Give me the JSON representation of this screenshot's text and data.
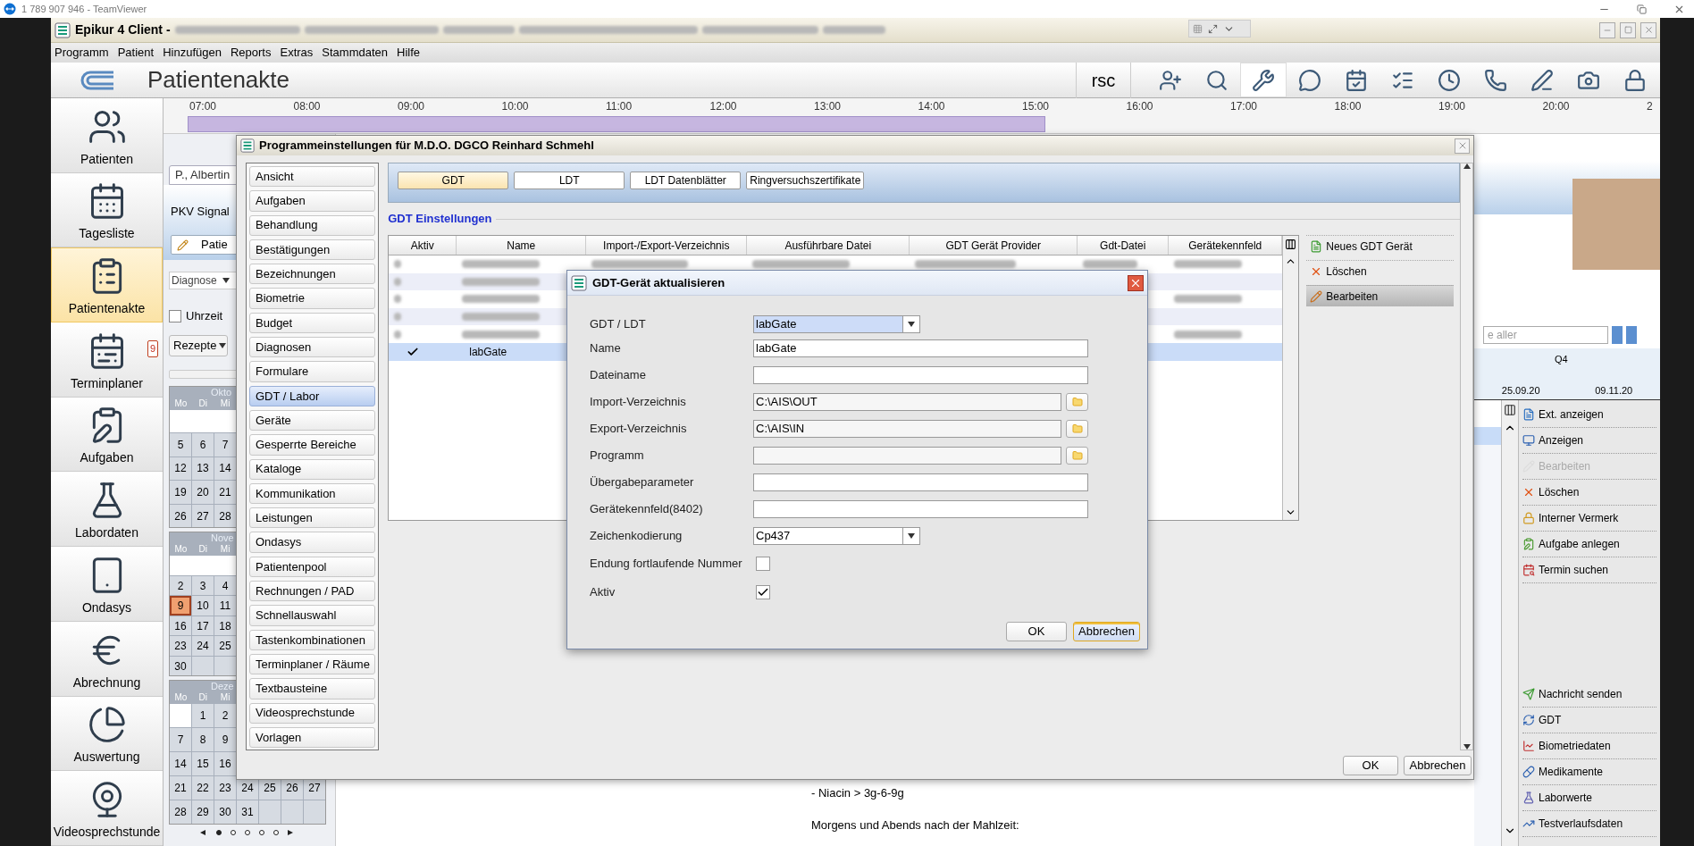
{
  "teamviewer": {
    "title": "1 789 907 946 - TeamViewer"
  },
  "app_window": {
    "title": "Epikur 4 Client -"
  },
  "menu": [
    "Programm",
    "Patient",
    "Hinzufügen",
    "Reports",
    "Extras",
    "Stammdaten",
    "Hilfe"
  ],
  "header": {
    "title": "Patientenakte",
    "user": "rsc",
    "toolbar": [
      {
        "kind": "add-patient",
        "selected": false
      },
      {
        "kind": "search-calendar",
        "selected": false
      },
      {
        "kind": "tools",
        "selected": true
      },
      {
        "kind": "chat",
        "selected": false
      },
      {
        "kind": "clipboard-calendar",
        "selected": false
      },
      {
        "kind": "clipboard-check",
        "selected": false
      },
      {
        "kind": "clipboard-clock",
        "selected": false
      },
      {
        "kind": "clipboard-phone",
        "selected": false
      },
      {
        "kind": "list-pen",
        "selected": false
      },
      {
        "kind": "camera",
        "selected": false
      },
      {
        "kind": "user-lock",
        "selected": false
      }
    ]
  },
  "nav": [
    {
      "label": "Patienten",
      "selected": false
    },
    {
      "label": "Tagesliste",
      "selected": false
    },
    {
      "label": "Patientenakte",
      "selected": true
    },
    {
      "label": "Terminplaner",
      "selected": false,
      "badge": "9"
    },
    {
      "label": "Aufgaben",
      "selected": false
    },
    {
      "label": "Labordaten",
      "selected": false
    },
    {
      "label": "Ondasys",
      "selected": false
    },
    {
      "label": "Abrechnung",
      "selected": false
    },
    {
      "label": "Auswertung",
      "selected": false
    },
    {
      "label": "Videosprechstunde",
      "selected": false
    }
  ],
  "timeline": {
    "hours": [
      "07:00",
      "08:00",
      "09:00",
      "10:00",
      "11:00",
      "12:00",
      "13:00",
      "14:00",
      "15:00",
      "16:00",
      "17:00",
      "18:00",
      "19:00",
      "20:00",
      "2"
    ]
  },
  "patient_panel": {
    "tab": "P., Albertin",
    "insurance": "PKV Signal",
    "patient_button": "Patie",
    "diagnosis_dropdown": "Diagnose",
    "time_checkbox": {
      "label": "Uhrzeit",
      "checked": false
    },
    "prescriptions_button": "Rezepte"
  },
  "calendar": {
    "months": [
      {
        "name": "Okto",
        "weekdays": [
          "Mo",
          "Di",
          "Mi"
        ],
        "weeks": [
          {
            "kind": "blank"
          },
          [
            {
              "day": "5",
              "selected": false
            },
            {
              "day": "6",
              "selected": false
            },
            {
              "day": "7",
              "selected": false
            }
          ],
          [
            {
              "day": "12",
              "selected": false
            },
            {
              "day": "13",
              "selected": false
            },
            {
              "day": "14",
              "selected": false
            }
          ],
          [
            {
              "day": "19",
              "selected": false
            },
            {
              "day": "20",
              "selected": false
            },
            {
              "day": "21",
              "selected": false
            }
          ],
          [
            {
              "day": "26",
              "selected": false
            },
            {
              "day": "27",
              "selected": false
            },
            {
              "day": "28",
              "selected": false
            }
          ]
        ]
      },
      {
        "name": "Nove",
        "weekdays": [
          "Mo",
          "Di",
          "Mi"
        ],
        "weeks": [
          {
            "kind": "blank"
          },
          [
            {
              "day": "2",
              "selected": false
            },
            {
              "day": "3",
              "selected": false
            },
            {
              "day": "4",
              "selected": false
            }
          ],
          [
            {
              "day": "9",
              "selected": true
            },
            {
              "day": "10",
              "selected": false
            },
            {
              "day": "11",
              "selected": false
            }
          ],
          [
            {
              "day": "16",
              "selected": false
            },
            {
              "day": "17",
              "selected": false
            },
            {
              "day": "18",
              "selected": false
            }
          ],
          [
            {
              "day": "23",
              "selected": false
            },
            {
              "day": "24",
              "selected": false
            },
            {
              "day": "25",
              "selected": false
            }
          ],
          [
            {
              "day": "30",
              "selected": false
            }
          ]
        ]
      },
      {
        "name": "Deze",
        "weekdays": [
          "Mo",
          "Di",
          "Mi"
        ],
        "weeks": [
          {
            "kind": "month_start",
            "days": [
              {
                "day": "1",
                "selected": false
              },
              {
                "day": "2",
                "selected": false
              }
            ]
          },
          [
            {
              "day": "7",
              "selected": false
            },
            {
              "day": "8",
              "selected": false
            },
            {
              "day": "9",
              "selected": false
            }
          ],
          [
            {
              "day": "14",
              "selected": false
            },
            {
              "day": "15",
              "selected": false
            },
            {
              "day": "16",
              "selected": false
            }
          ],
          [
            {
              "day": "21",
              "selected": false
            },
            {
              "day": "22",
              "selected": false
            },
            {
              "day": "23",
              "selected": false
            },
            {
              "day": "24",
              "selected": false
            },
            {
              "day": "25",
              "selected": false
            },
            {
              "day": "26",
              "selected": false
            },
            {
              "day": "27",
              "selected": false
            }
          ],
          [
            {
              "day": "28",
              "selected": false
            },
            {
              "day": "29",
              "selected": false
            },
            {
              "day": "30",
              "selected": false
            },
            {
              "day": "31",
              "selected": false
            }
          ]
        ]
      }
    ],
    "pager": [
      {
        "selected": true
      },
      {
        "selected": false
      },
      {
        "selected": false
      },
      {
        "selected": false
      },
      {
        "selected": false
      }
    ]
  },
  "notes": [
    "- Niacin > 3g-6-9g",
    "Morgens und Abends nach der Mahlzeit:"
  ],
  "right_panel": {
    "search_value": "e aller",
    "period": "Q4",
    "dates": [
      "25.09.20",
      "09.11.20"
    ],
    "actions_top": [
      {
        "label": "Ext. anzeigen",
        "disabled": false
      },
      {
        "label": "Anzeigen",
        "disabled": false
      },
      {
        "label": "Bearbeiten",
        "disabled": true
      },
      {
        "label": "Löschen",
        "disabled": false
      },
      {
        "label": "Interner Vermerk",
        "disabled": false
      },
      {
        "label": "Aufgabe anlegen",
        "disabled": false
      },
      {
        "label": "Termin suchen",
        "disabled": false
      }
    ],
    "actions_bottom": [
      {
        "label": "Nachricht senden",
        "disabled": false
      },
      {
        "label": "GDT",
        "disabled": false
      },
      {
        "label": "Biometriedaten",
        "disabled": false
      },
      {
        "label": "Medikamente",
        "disabled": false
      },
      {
        "label": "Laborwerte",
        "disabled": false
      },
      {
        "label": "Testverlaufsdaten",
        "disabled": false
      }
    ]
  },
  "settings_dialog": {
    "title": "Programmeinstellungen für M.D.O. DGCO Reinhard Schmehl",
    "categories": [
      {
        "label": "Ansicht",
        "selected": false
      },
      {
        "label": "Aufgaben",
        "selected": false
      },
      {
        "label": "Behandlung",
        "selected": false
      },
      {
        "label": "Bestätigungen",
        "selected": false
      },
      {
        "label": "Bezeichnungen",
        "selected": false
      },
      {
        "label": "Biometrie",
        "selected": false
      },
      {
        "label": "Budget",
        "selected": false
      },
      {
        "label": "Diagnosen",
        "selected": false
      },
      {
        "label": "Formulare",
        "selected": false
      },
      {
        "label": "GDT / Labor",
        "selected": true
      },
      {
        "label": "Geräte",
        "selected": false
      },
      {
        "label": "Gesperrte Bereiche",
        "selected": false
      },
      {
        "label": "Kataloge",
        "selected": false
      },
      {
        "label": "Kommunikation",
        "selected": false
      },
      {
        "label": "Leistungen",
        "selected": false
      },
      {
        "label": "Ondasys",
        "selected": false
      },
      {
        "label": "Patientenpool",
        "selected": false
      },
      {
        "label": "Rechnungen / PAD",
        "selected": false
      },
      {
        "label": "Schnellauswahl",
        "selected": false
      },
      {
        "label": "Tastenkombinationen",
        "selected": false
      },
      {
        "label": "Terminplaner / Räume",
        "selected": false
      },
      {
        "label": "Textbausteine",
        "selected": false
      },
      {
        "label": "Videosprechstunde",
        "selected": false
      },
      {
        "label": "Vorlagen",
        "selected": false
      }
    ],
    "tabs": [
      {
        "label": "GDT",
        "selected": true
      },
      {
        "label": "LDT",
        "selected": false
      },
      {
        "label": "LDT Datenblätter",
        "selected": false
      },
      {
        "label": "Ringversuchszertifikate",
        "selected": false
      }
    ],
    "section_title": "GDT Einstellungen",
    "table": {
      "columns": [
        "Aktiv",
        "Name",
        "Import-/Export-Verzeichnis",
        "Ausführbare Datei",
        "GDT Gerät Provider",
        "Gdt-Datei",
        "Gerätekennfeld"
      ],
      "rows": [
        {
          "kind": "redacted"
        },
        {
          "kind": "redacted"
        },
        {
          "kind": "redacted"
        },
        {
          "kind": "redacted"
        },
        {
          "kind": "redacted"
        },
        {
          "kind": "entry",
          "aktiv": true,
          "name": "labGate",
          "selected": true
        }
      ]
    },
    "side_buttons": [
      {
        "label": "Neues GDT Gerät",
        "selected": false
      },
      {
        "label": "Löschen",
        "selected": false
      },
      {
        "label": "Bearbeiten",
        "selected": true
      }
    ],
    "buttons": [
      "OK",
      "Abbrechen"
    ]
  },
  "gdt_dialog": {
    "title": "GDT-Gerät aktualisieren",
    "fields": [
      {
        "kind": "combo",
        "label": "GDT / LDT",
        "value": "labGate",
        "focused": true
      },
      {
        "kind": "text",
        "label": "Name",
        "value": "labGate"
      },
      {
        "kind": "text",
        "label": "Dateiname"
      },
      {
        "kind": "path",
        "label": "Import-Verzeichnis",
        "value": "C:\\AIS\\OUT"
      },
      {
        "kind": "path",
        "label": "Export-Verzeichnis",
        "value": "C:\\AIS\\IN"
      },
      {
        "kind": "path",
        "label": "Programm"
      },
      {
        "kind": "text",
        "label": "Übergabeparameter"
      },
      {
        "kind": "text",
        "label": "Gerätekennfeld(8402)"
      },
      {
        "kind": "combo",
        "label": "Zeichenkodierung",
        "value": "Cp437",
        "focused": false
      },
      {
        "kind": "checkbox",
        "label": "Endung fortlaufende Nummer",
        "checked": false
      },
      {
        "kind": "checkbox",
        "label": "Aktiv",
        "checked": true
      }
    ],
    "buttons": [
      {
        "label": "OK",
        "selected": false
      },
      {
        "label": "Abbrechen",
        "selected": true
      }
    ]
  }
}
